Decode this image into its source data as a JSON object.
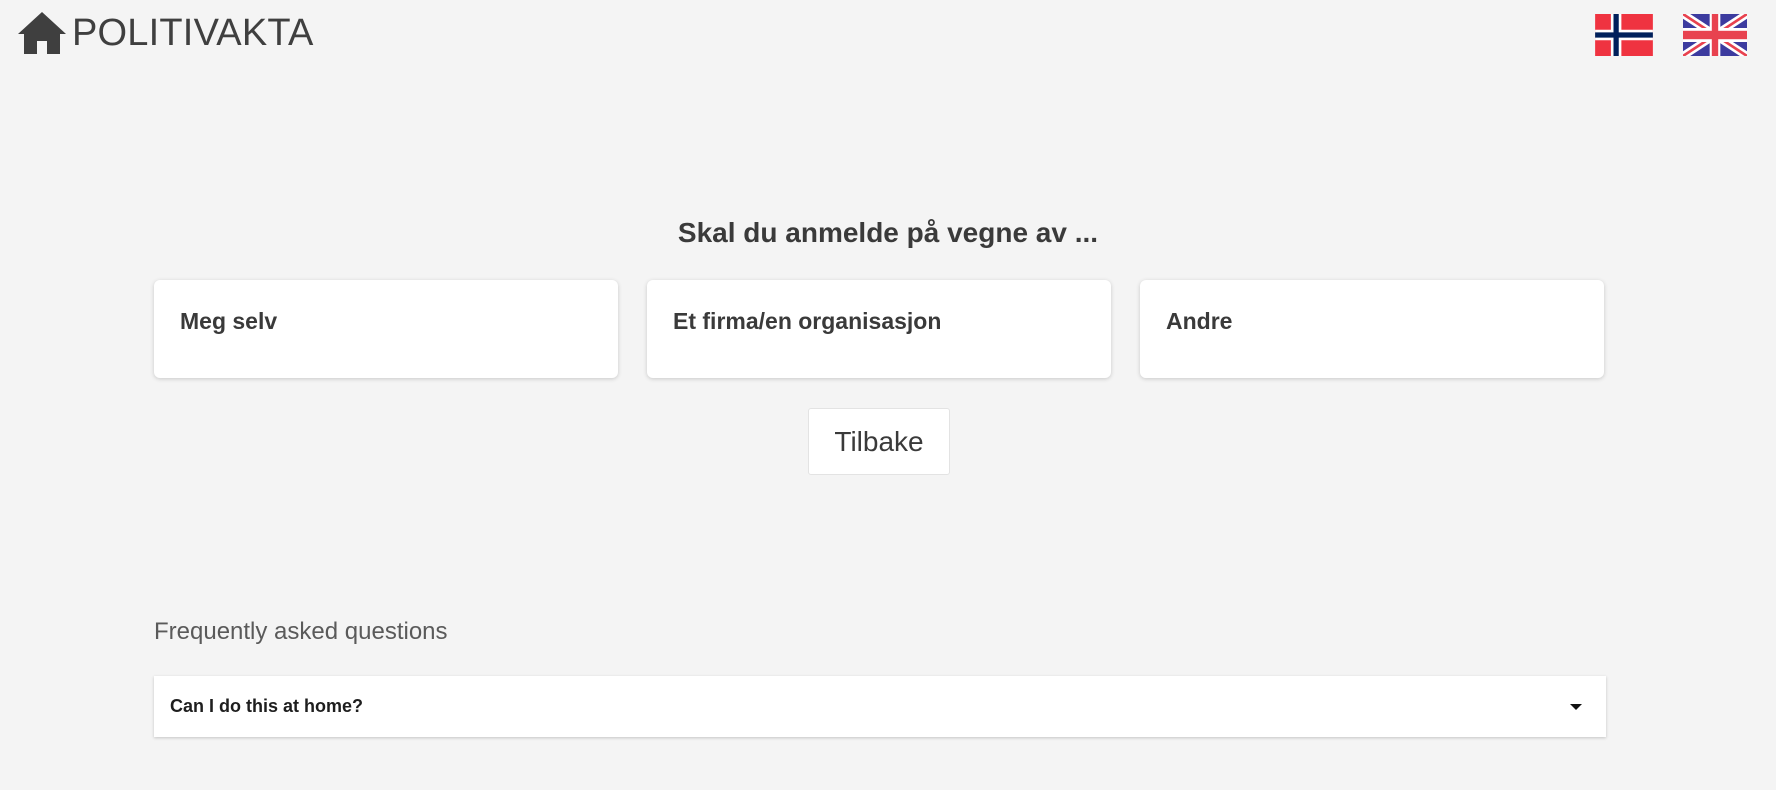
{
  "header": {
    "brand": "POLITIVAKTA",
    "home_icon": "home-icon"
  },
  "languages": [
    {
      "code": "no",
      "icon": "norway-flag-icon"
    },
    {
      "code": "en",
      "icon": "uk-flag-icon"
    }
  ],
  "main": {
    "question": "Skal du anmelde på vegne av ...",
    "options": [
      {
        "label": "Meg selv"
      },
      {
        "label": "Et firma/en organisasjon"
      },
      {
        "label": "Andre"
      }
    ],
    "back_label": "Tilbake"
  },
  "faq": {
    "title": "Frequently asked questions",
    "items": [
      {
        "question": "Can I do this at home?",
        "expanded": false
      }
    ]
  },
  "colors": {
    "background": "#f4f4f4",
    "card": "#ffffff",
    "text": "#3a3a3a"
  }
}
